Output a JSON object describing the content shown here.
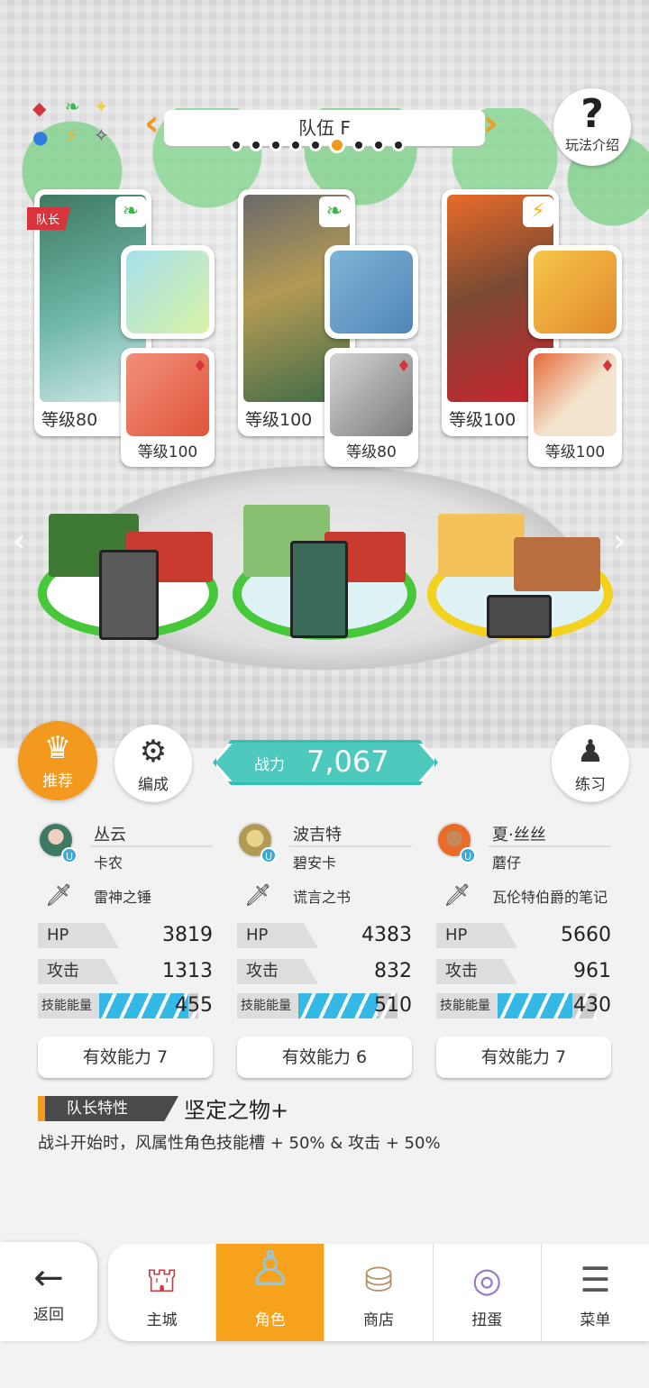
{
  "header": {
    "team_name": "队伍 F",
    "prev_arrow": "‹",
    "next_arrow": "›",
    "page_count": 9,
    "active_page": 6,
    "howto_label": "玩法介绍",
    "howto_icon": "?"
  },
  "elements": [
    "◆",
    "❧",
    "✦",
    "●",
    "⚡",
    "✧"
  ],
  "party": [
    {
      "leader_tag": "队长",
      "level": "等级80",
      "element_icon": "leaf-icon",
      "weapon_icon": "hammer-icon",
      "sub_level": "等级100"
    },
    {
      "level": "等级100",
      "element_icon": "leaf-icon",
      "weapon_icon": "book-icon",
      "sub_level": "等级80"
    },
    {
      "level": "等级100",
      "element_icon": "lightning-icon",
      "weapon_icon": "notebook-icon",
      "sub_level": "等级100"
    }
  ],
  "actions": {
    "recommend": "推荐",
    "organize": "编成",
    "practice": "练习",
    "power_label": "战力",
    "power_value": "7,067"
  },
  "characters": [
    {
      "name": "丛云",
      "title": "卡农",
      "gear": "雷神之锤",
      "hp_label": "HP",
      "hp": "3819",
      "atk_label": "攻击",
      "atk": "1313",
      "energy_label": "技能能量",
      "energy": "455",
      "energy_fill": 0.9,
      "effect": "有效能力 7"
    },
    {
      "name": "波吉特",
      "title": "碧安卡",
      "gear": "谎言之书",
      "hp_label": "HP",
      "hp": "4383",
      "atk_label": "攻击",
      "atk": "832",
      "energy_label": "技能能量",
      "energy": "510",
      "energy_fill": 0.8,
      "effect": "有效能力 6"
    },
    {
      "name": "夏·丝丝",
      "title": "蘑仔",
      "gear": "瓦伦特伯爵的笔记",
      "hp_label": "HP",
      "hp": "5660",
      "atk_label": "攻击",
      "atk": "961",
      "energy_label": "技能能量",
      "energy": "430",
      "energy_fill": 0.75,
      "effect": "有效能力 7"
    }
  ],
  "leader_trait": {
    "label": "队长特性",
    "name": "坚定之物+",
    "description": "战斗开始时，风属性角色技能槽 + 50% & 攻击 + 50%"
  },
  "nav": {
    "back": "返回",
    "tabs": [
      "主城",
      "角色",
      "商店",
      "扭蛋",
      "菜单"
    ],
    "active": "角色"
  },
  "colors": {
    "accent": "#f39a1e",
    "power": "#4ec9be",
    "energy": "#34b8e6",
    "leader_tag": "#d9333b"
  }
}
